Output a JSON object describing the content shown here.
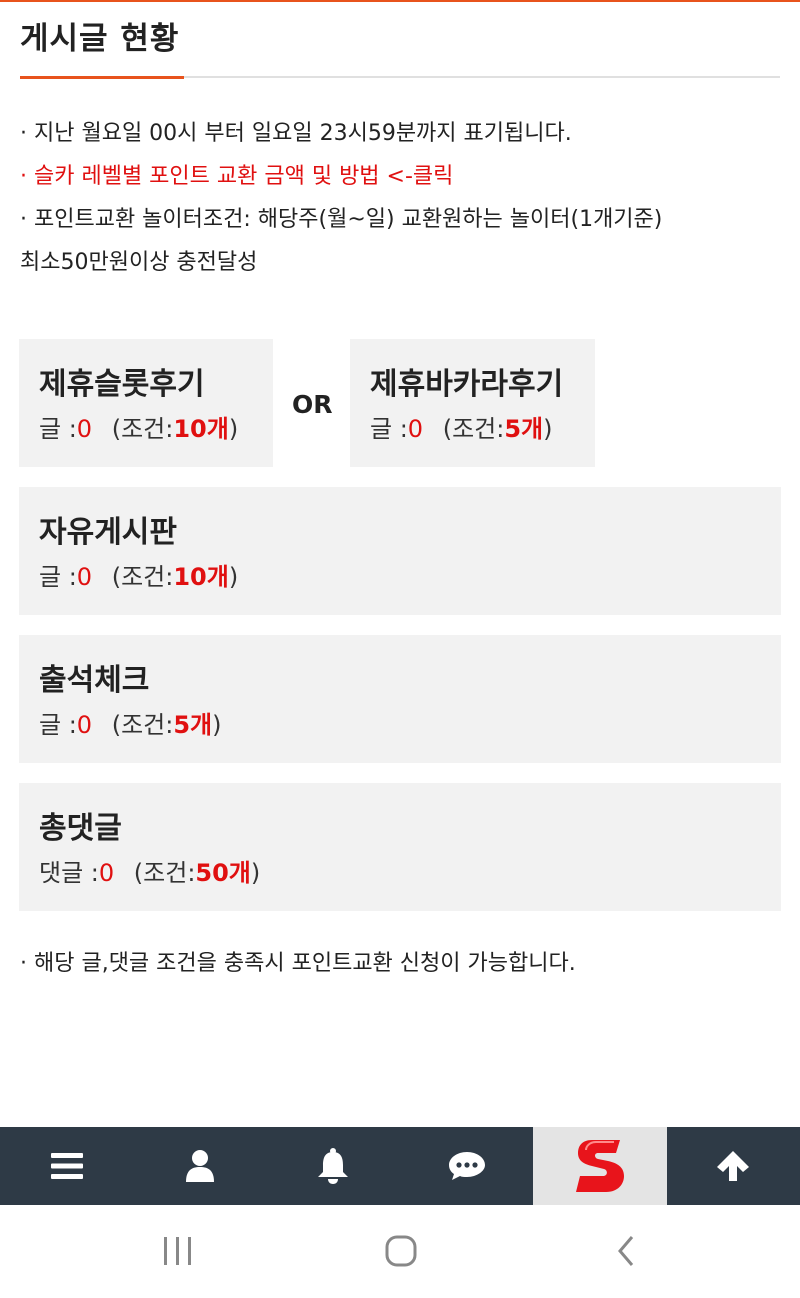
{
  "header": {
    "title": "게시글 현황"
  },
  "notes": [
    "· 지난 월요일 00시 부터 일요일 23시59분까지 표기됩니다.",
    "· 슬카 레벨별 포인트 교환 금액 및 방법 <-클릭",
    "· 포인트교환 놀이터조건: 해당주(월~일) 교환원하는 놀이터(1개기준)",
    "최소50만원이상 충전달성"
  ],
  "or_label": "OR",
  "cards": [
    {
      "name": "제휴슬롯후기",
      "label": "글 :",
      "count": "0",
      "cond_open": "(조건:",
      "cond": "10개",
      "cond_close": ")"
    },
    {
      "name": "제휴바카라후기",
      "label": "글 :",
      "count": "0",
      "cond_open": "(조건:",
      "cond": "5개",
      "cond_close": ")"
    },
    {
      "name": "자유게시판",
      "label": "글 :",
      "count": "0",
      "cond_open": "(조건:",
      "cond": "10개",
      "cond_close": ")"
    },
    {
      "name": "출석체크",
      "label": "글 :",
      "count": "0",
      "cond_open": "(조건:",
      "cond": "5개",
      "cond_close": ")"
    },
    {
      "name": "총댓글",
      "label": "댓글 :",
      "count": "0",
      "cond_open": "(조건:",
      "cond": "50개",
      "cond_close": ")"
    }
  ],
  "bottom_note": "· 해당 글,댓글 조건을 충족시 포인트교환 신청이 가능합니다.",
  "navbar": {
    "items": [
      "menu-icon",
      "user-icon",
      "bell-icon",
      "chat-icon",
      "logo-s",
      "arrow-up-icon"
    ]
  },
  "colors": {
    "accent": "#e8531c",
    "red": "#e01010",
    "nav_bg": "#2e3a46",
    "card_bg": "#f2f2f2"
  }
}
